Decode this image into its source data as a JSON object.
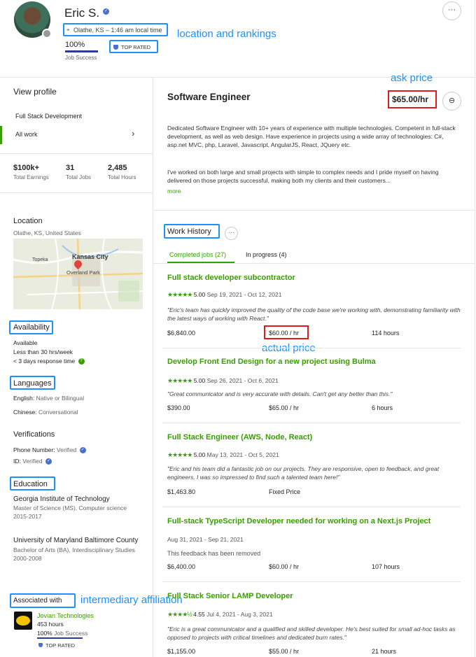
{
  "profile": {
    "name": "Eric S.",
    "location": "Olathe, KS – 1:46 am local time",
    "job_success_value": "100%",
    "job_success_label": "Job Success",
    "top_rated": "TOP RATED",
    "job_success_fraction": 1.0
  },
  "sidebar": {
    "view_profile": "View profile",
    "specialization": "Full Stack Development",
    "all_work": "All work",
    "stats": [
      {
        "value": "$100k+",
        "label": "Total Earnings"
      },
      {
        "value": "31",
        "label": "Total Jobs"
      },
      {
        "value": "2,485",
        "label": "Total Hours"
      }
    ],
    "location_heading": "Location",
    "location_value": "Olathe, KS, United States",
    "map_labels": [
      "Kansas City",
      "Topeka",
      "Overland Park"
    ],
    "availability_heading": "Availability",
    "availability_status": "Available",
    "availability_hours": "Less than 30 hrs/week",
    "availability_response": "< 3 days response time",
    "languages_heading": "Languages",
    "languages": [
      {
        "name": "English:",
        "level": "Native or Bilingual"
      },
      {
        "name": "Chinese:",
        "level": "Conversational"
      }
    ],
    "verifications_heading": "Verifications",
    "verifications": [
      {
        "name": "Phone Number:",
        "status": "Verified"
      },
      {
        "name": "ID:",
        "status": "Verified"
      }
    ],
    "education_heading": "Education",
    "education": [
      {
        "school": "Georgia Institute of Technology",
        "degree": "Master of Science (MS), Computer science",
        "years": "2015-2017"
      },
      {
        "school": "University of Maryland Baltimore County",
        "degree": "Bachelor of Arts (BA), Interdisciplinary Studies",
        "years": "2000-2008"
      }
    ],
    "associated_heading": "Associated with",
    "agency": {
      "name": "Jovian Technologies",
      "hours": "453 hours",
      "job_success_value": "100%",
      "job_success_label": "Job Success",
      "top_rated": "TOP RATED"
    }
  },
  "main": {
    "title": "Software Engineer",
    "rate": "$65.00/hr",
    "overview_p1": "Dedicated Software Engineer with 10+ years of experience with multiple technologies. Competent in full-stack development, as well as web design. Have experience in projects using a wide array of technologies: C#, asp.net MVC, php, Laravel, Javascript, AngularJS, React, JQuery etc.",
    "overview_p2": "I've worked on both large and small projects with simple to complex needs and I pride myself on having delivered on those projects successful, making both my clients and their customers...",
    "more_link": "more",
    "work_history_heading": "Work History",
    "tabs": [
      "Completed jobs (27)",
      "In progress (4)"
    ],
    "jobs": [
      {
        "title": "Full stack developer subcontractor",
        "rating": "5.00",
        "dates": "Sep 19, 2021 - Oct 12, 2021",
        "quote": "\"Eric's team has quickly improved the quality of the code base we're working with, demonstrating familiarity with the latest ways of working with React.\"",
        "earned": "$6,840.00",
        "rate": "$60.00 / hr",
        "hours": "114 hours"
      },
      {
        "title": "Develop Front End Design for a new project using Bulma",
        "rating": "5.00",
        "dates": "Sep 26, 2021 - Oct 6, 2021",
        "quote": "\"Great communicator and is very accurate with details. Can't get any better than this.\"",
        "earned": "$390.00",
        "rate": "$65.00 / hr",
        "hours": "6 hours"
      },
      {
        "title": "Full Stack Engineer (AWS, Node, React)",
        "rating": "5.00",
        "dates": "May 13, 2021 - Oct 5, 2021",
        "quote": "\"Eric and his team did a fantastic job on our projects. They are responsive, open to feedback, and great engineers. I was so impressed to find such a talented team here!\"",
        "earned": "$1,463.80",
        "rate": "Fixed Price",
        "hours": ""
      },
      {
        "title": "Full-stack TypeScript Developer needed for working on a Next.js Project",
        "rating": "",
        "dates": "Aug 31, 2021 - Sep 21, 2021",
        "quote": "This feedback has been removed",
        "earned": "$6,400.00",
        "rate": "$60.00 / hr",
        "hours": "107 hours"
      },
      {
        "title": "Full Stack Senior LAMP Developer",
        "rating": "4.55",
        "dates": "Jul 4, 2021 - Aug 3, 2021",
        "quote": "\"Eric is a great communicator and a qualified and skilled developer. He's best suited for small ad-hoc tasks as opposed to projects with critical timelines and dedicated burn rates.\"",
        "earned": "$1,155.00",
        "rate": "$55.00 / hr",
        "hours": "21 hours"
      }
    ]
  },
  "annotations": {
    "location_rankings": "location and rankings",
    "ask_price": "ask price",
    "actual_price": "actual price",
    "intermediary": "intermediary affiliation"
  },
  "colors": {
    "accent_green": "#37a000",
    "annotation_blue": "#1e90ff",
    "price_red": "#e01b1b"
  }
}
